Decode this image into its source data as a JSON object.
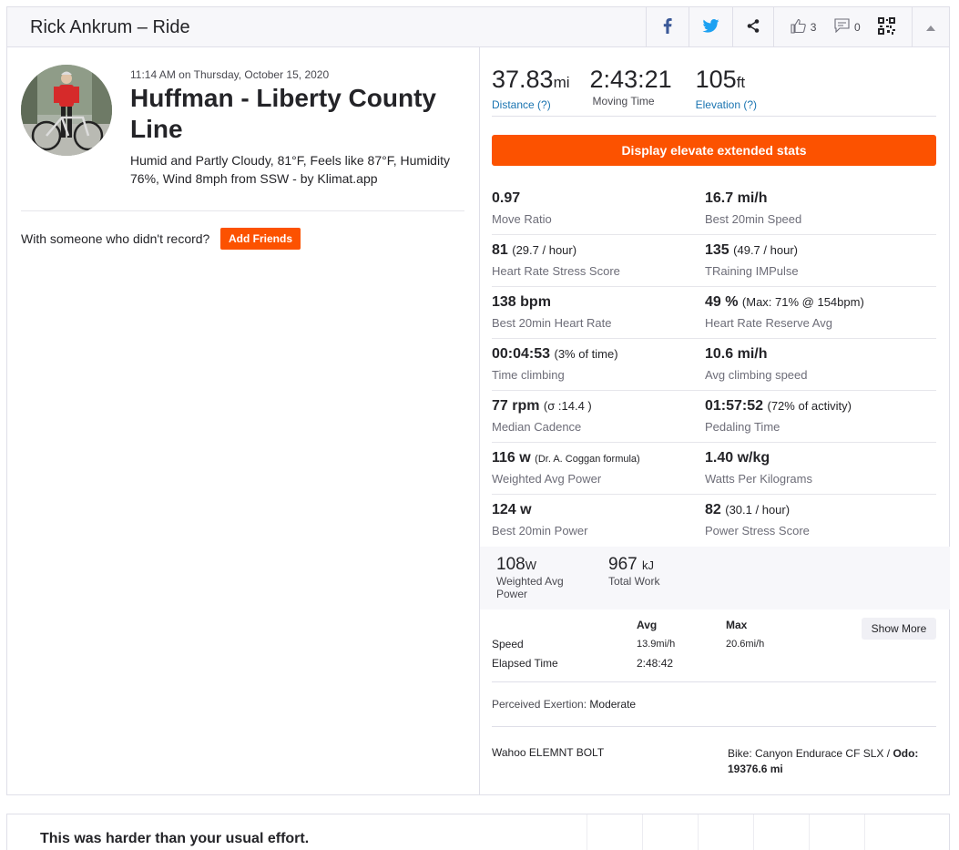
{
  "header": {
    "title": "Rick Ankrum – Ride",
    "kudos_count": "3",
    "comments_count": "0"
  },
  "activity": {
    "timestamp": "11:14 AM on Thursday, October 15, 2020",
    "title": "Huffman - Liberty County Line",
    "description": "Humid and Partly Cloudy, 81°F, Feels like 87°F, Humidity 76%, Wind 8mph from SSW - by Klimat.app",
    "with_someone_text": "With someone who didn't record?",
    "add_friends_label": "Add Friends"
  },
  "inline_stats": [
    {
      "value": "37.83",
      "unit": "mi",
      "label": "Distance (?)"
    },
    {
      "value": "2:43:21",
      "unit": "",
      "label": "Moving Time"
    },
    {
      "value": "105",
      "unit": "ft",
      "label": "Elevation (?)"
    }
  ],
  "elevate_button": "Display elevate extended stats",
  "extended_stats": [
    [
      {
        "value": "0.97",
        "extra": "",
        "label": "Move Ratio"
      },
      {
        "value": "16.7 mi/h",
        "extra": "",
        "label": "Best 20min Speed"
      }
    ],
    [
      {
        "value": "81",
        "extra": "(29.7 / hour)",
        "label": "Heart Rate Stress Score"
      },
      {
        "value": "135",
        "extra": "(49.7 / hour)",
        "label": "TRaining IMPulse"
      }
    ],
    [
      {
        "value": "138 bpm",
        "extra": "",
        "label": "Best 20min Heart Rate"
      },
      {
        "value": "49 %",
        "extra": "(Max: 71% @ 154bpm)",
        "label": "Heart Rate Reserve Avg"
      }
    ],
    [
      {
        "value": "00:04:53",
        "extra": "(3% of time)",
        "label": "Time climbing"
      },
      {
        "value": "10.6 mi/h",
        "extra": "",
        "label": "Avg climbing speed"
      }
    ],
    [
      {
        "value": "77 rpm",
        "extra": "(σ :14.4 )",
        "label": "Median Cadence"
      },
      {
        "value": "01:57:52",
        "extra": "(72% of activity)",
        "label": "Pedaling Time"
      }
    ],
    [
      {
        "value": "116 w",
        "extra": "(Dr. A. Coggan formula)",
        "label": "Weighted Avg Power"
      },
      {
        "value": "1.40 w/kg",
        "extra": "",
        "label": "Watts Per Kilograms"
      }
    ],
    [
      {
        "value": "124 w",
        "extra": "",
        "label": "Best 20min Power"
      },
      {
        "value": "82",
        "extra": "(30.1 / hour)",
        "label": "Power Stress Score"
      }
    ]
  ],
  "power_stats": [
    {
      "value": "108",
      "unit": "W",
      "label": "Weighted Avg Power"
    },
    {
      "value": "967",
      "unit": "kJ",
      "label": "Total Work"
    }
  ],
  "more_stats": {
    "headers": [
      "Avg",
      "Max"
    ],
    "rows": [
      {
        "label": "Speed",
        "avg": "13.9mi/h",
        "max": "20.6mi/h"
      },
      {
        "label": "Elapsed Time",
        "avg": "2:48:42",
        "max": ""
      }
    ],
    "show_more_label": "Show More"
  },
  "exertion": {
    "label": "Perceived Exertion:",
    "value": "Moderate"
  },
  "device": "Wahoo ELEMNT BOLT",
  "bike": {
    "label": "Bike: Canyon Endurace CF SLX /",
    "odo_label": "Odo:",
    "odo_value": "19376.6 mi"
  },
  "effort_card": {
    "text": "This was harder than your usual effort."
  },
  "colors": {
    "accent": "#fc5200",
    "link": "#1a74b1",
    "facebook": "#3b5998",
    "twitter": "#1da1f2"
  }
}
